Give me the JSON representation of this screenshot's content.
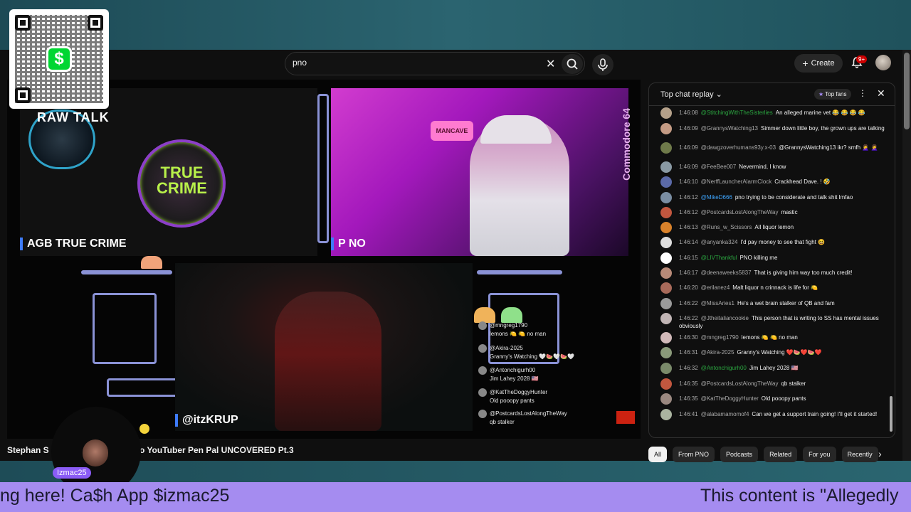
{
  "search": {
    "query": "pno"
  },
  "masthead": {
    "create_label": "Create",
    "notif_count": "9+"
  },
  "panels": {
    "agb_label": "AGB TRUE CRIME",
    "pno_label": "P NO",
    "krup_label": "@itzKRUP",
    "raw_talk": "RAW TALK",
    "true_crime": "TRUE CRIME",
    "mancave": "MANCAVE",
    "commodore": "Commodore 64"
  },
  "mini_chat": [
    {
      "author": "@mngreg1790",
      "text": "lemons 🍋 🍋 no man"
    },
    {
      "author": "@Akira-2025",
      "text": "Granny's Watching 🤍🍉🤍🍉🤍"
    },
    {
      "author": "@Antonchigurh00",
      "text": "Jim Lahey 2028 🇺🇸"
    },
    {
      "author": "@KatTheDoggyHunter",
      "text": "Old pooopy pants"
    },
    {
      "author": "@PostcardsLostAlongTheWay",
      "text": "qb stalker"
    }
  ],
  "video": {
    "title_left": "Stephan S",
    "title_right": "o YouTuber Pen Pal UNCOVERED Pt.3"
  },
  "stream": {
    "username": "Izmac25"
  },
  "ticker": {
    "left": "ng here! Ca$h App $izmac25",
    "right": "This content is \"Allegedly"
  },
  "chat": {
    "title": "Top chat replay",
    "top_fans": "Top fans",
    "messages": [
      {
        "time": "1:46:08",
        "author": "@StitchingWithTheSisterlies",
        "member": true,
        "text": "An alleged marine vet 😂 😂 😂 😂",
        "color": "#b5a18a"
      },
      {
        "time": "1:46:09",
        "author": "@GrannysWatching13",
        "member": false,
        "text": "Simmer down little boy, the grown ups are talking",
        "color": "#c49b84"
      },
      {
        "time": "1:46:09",
        "author": "@dawgzoverhumans93y.x-03",
        "member": false,
        "text": "@GrannysWatching13 ikr? smfh 🤦‍♀️ 🤦‍♀️",
        "color": "#6f7a4a"
      },
      {
        "time": "1:46:09",
        "author": "@FeeBee007",
        "member": false,
        "text": "Nevermind, I know",
        "color": "#8a9aa4"
      },
      {
        "time": "1:46:10",
        "author": "@NerffLauncherAlarmClock",
        "member": false,
        "text": "Crackhead Dave. ! 🤣",
        "color": "#5b6aa8"
      },
      {
        "time": "1:46:12",
        "author": "@MikeD666",
        "member": true,
        "text": "pno trying to be considerate and talk shit lmfao",
        "color": "#7a8da2",
        "blue": true
      },
      {
        "time": "1:46:12",
        "author": "@PostcardsLostAlongTheWay",
        "member": false,
        "text": "mastic",
        "color": "#c2573f"
      },
      {
        "time": "1:46:13",
        "author": "@Runs_w_Scissors",
        "member": false,
        "text": "All liquor lemon",
        "color": "#d9822b"
      },
      {
        "time": "1:46:14",
        "author": "@anyanka324",
        "member": false,
        "text": "I'd pay money to see that fight 😆",
        "color": "#dddddd"
      },
      {
        "time": "1:46:15",
        "author": "@LIVThankful",
        "member": true,
        "text": "PNO killing me",
        "color": "#ffffff"
      },
      {
        "time": "1:46:17",
        "author": "@deenaweeks5837",
        "member": false,
        "text": "That is giving him way too much credit!",
        "color": "#b88a78"
      },
      {
        "time": "1:46:20",
        "author": "@erilanez4",
        "member": false,
        "text": "Malt liquor n crinnack is life for 🍋",
        "color": "#a86a5a"
      },
      {
        "time": "1:46:22",
        "author": "@MissAries1",
        "member": false,
        "text": "He's a wet brain stalker of QB and fam",
        "color": "#9a9a9a"
      },
      {
        "time": "1:46:22",
        "author": "@Jtheitaliancookie",
        "member": false,
        "text": "This person that is writing to SS has mental issues obviously",
        "color": "#c0b4b4"
      },
      {
        "time": "1:46:30",
        "author": "@mngreg1790",
        "member": false,
        "text": "lemons 🍋 🍋 no man",
        "color": "#d1b9b9"
      },
      {
        "time": "1:46:31",
        "author": "@Akira-2025",
        "member": false,
        "text": "Granny's Watching ❤️🍉❤️🍉❤️",
        "color": "#8a9a7a"
      },
      {
        "time": "1:46:32",
        "author": "@Antonchigurh00",
        "member": true,
        "text": "Jim Lahey 2028 🇺🇸",
        "color": "#7a8a6a"
      },
      {
        "time": "1:46:35",
        "author": "@PostcardsLostAlongTheWay",
        "member": false,
        "text": "qb stalker",
        "color": "#c2573f"
      },
      {
        "time": "1:46:35",
        "author": "@KatTheDoggyHunter",
        "member": false,
        "text": "Old pooopy pants",
        "color": "#9a8880"
      },
      {
        "time": "1:46:41",
        "author": "@alabamamomof4",
        "member": false,
        "text": "Can we get a support train going! I'll get it started!",
        "color": "#aab4a0"
      }
    ]
  },
  "chips": [
    "All",
    "From PNO",
    "Podcasts",
    "Related",
    "For you",
    "Recently"
  ],
  "colors": {
    "accent_purple": "#8b5cf6",
    "ticker_bg": "#a58cf0",
    "cashapp_green": "#00d632"
  }
}
